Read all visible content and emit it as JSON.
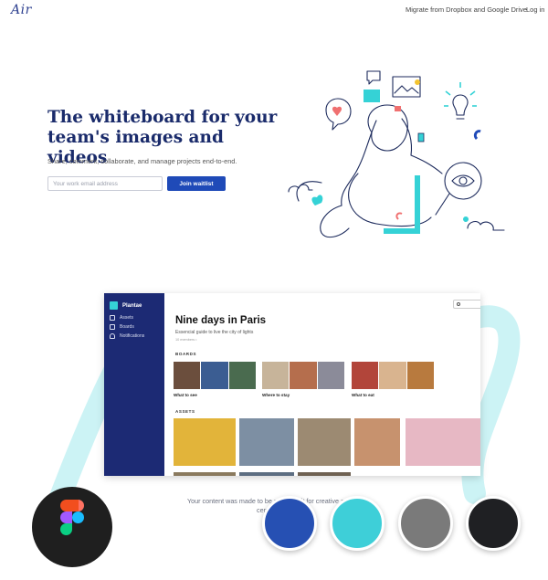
{
  "nav": {
    "logo": "Air",
    "migrate_link": "Migrate from Dropbox and Google Drive",
    "login_link": "Log in"
  },
  "hero": {
    "title": "The whiteboard for your team's images and videos",
    "subtitle": "Share, comment, collaborate, and manage projects end-to-end.",
    "email_placeholder": "Your work email address",
    "cta_label": "Join waitlist"
  },
  "app": {
    "workspace_name": "Plantae",
    "sidebar": [
      {
        "label": "Assets",
        "icon": "assets-icon"
      },
      {
        "label": "Boards",
        "icon": "boards-icon"
      },
      {
        "label": "Notifications",
        "icon": "bell-icon"
      }
    ],
    "board_title": "Nine days in Paris",
    "board_description": "Essencial guide to live the city of lights",
    "board_members": "10 members •",
    "boards_label": "BOARDS",
    "assets_label": "ASSETS",
    "boards": [
      {
        "caption": "What to see",
        "colors": [
          "#6b4e3d",
          "#3b5d92",
          "#4a6b4f"
        ]
      },
      {
        "caption": "Where to stay",
        "colors": [
          "#c7b49a",
          "#b56e4d",
          "#8b8b99"
        ]
      },
      {
        "caption": "What to eat",
        "colors": [
          "#b2453a",
          "#d9b48f",
          "#b87a3e"
        ]
      }
    ],
    "assets": [
      {
        "color": "#e2b43a"
      },
      {
        "color": "#7d8fa3"
      },
      {
        "color": "#9c8a72"
      },
      {
        "color": "#c7926e"
      },
      {
        "color": "#e7b8c4"
      }
    ]
  },
  "footer": {
    "text_line1": "Your content was made to be seen. Built for creative and",
    "text_line2": "centre of"
  },
  "swatches": [
    "#2650b3",
    "#3ecfd8",
    "#7a7a7a",
    "#1f2023"
  ],
  "colors": {
    "brand": "#1f4ab8",
    "navy_text": "#1a2b6b",
    "teal_accent": "#35d2d6",
    "sidebar": "#1c2a74"
  }
}
